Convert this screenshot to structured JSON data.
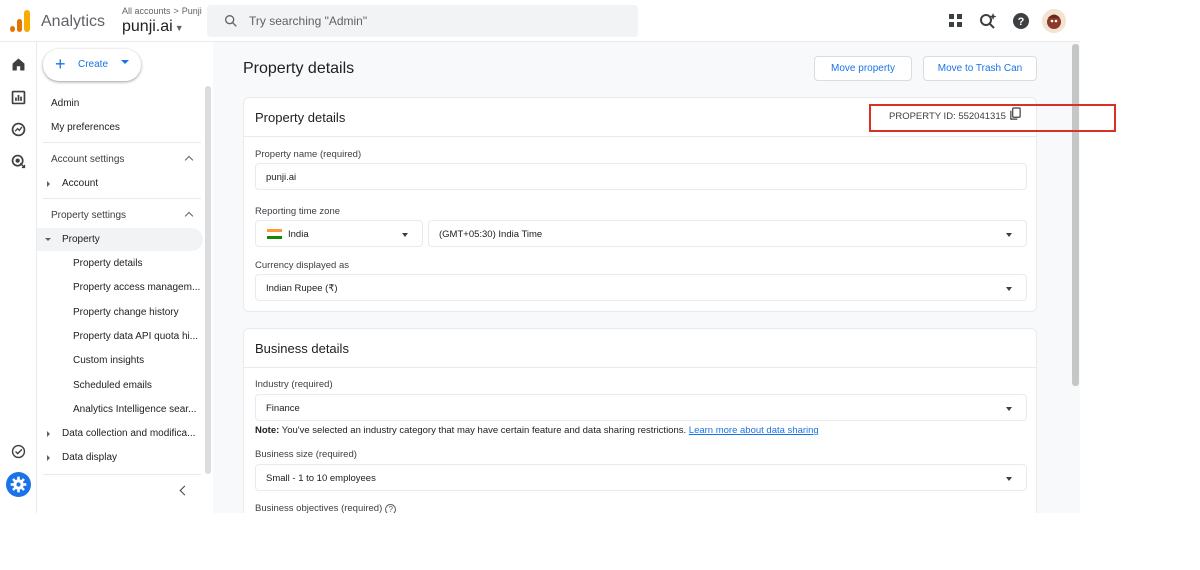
{
  "header": {
    "app_title": "Analytics",
    "breadcrumb": [
      "All accounts",
      "Punji"
    ],
    "account_name": "punji.ai",
    "search_placeholder": "Try searching \"Admin\""
  },
  "icons": {
    "top": [
      "apps-grid-icon",
      "search-insights-icon",
      "help-icon",
      "avatar"
    ],
    "rail": [
      "home-icon",
      "reports-icon",
      "explore-icon",
      "advertising-icon",
      "checklist-icon",
      "admin-gear-icon"
    ]
  },
  "nav": {
    "create_label": "Create",
    "admin": "Admin",
    "my_preferences": "My preferences",
    "account_settings": "Account settings",
    "account": "Account",
    "property_settings": "Property settings",
    "property": "Property",
    "property_items": [
      "Property details",
      "Property access managem...",
      "Property change history",
      "Property data API quota hi...",
      "Custom insights",
      "Scheduled emails",
      "Analytics Intelligence sear..."
    ],
    "data_collection": "Data collection and modifica...",
    "data_display": "Data display"
  },
  "page": {
    "title": "Property details",
    "move_property": "Move property",
    "move_to_trash": "Move to Trash Can"
  },
  "property_card": {
    "title": "Property details",
    "property_id": "PROPERTY ID: 552041315",
    "name_label": "Property name (required)",
    "name_value": "punji.ai",
    "timezone_label": "Reporting time zone",
    "country_value": "India",
    "timezone_value": "(GMT+05:30) India Time",
    "currency_label": "Currency displayed as",
    "currency_value": "Indian Rupee (₹)"
  },
  "business_card": {
    "title": "Business details",
    "industry_label": "Industry (required)",
    "industry_value": "Finance",
    "note_bold": "Note:",
    "note_text": " You've selected an industry category that may have certain feature and data sharing restrictions. ",
    "note_link": "Learn more about data sharing",
    "size_label": "Business size (required)",
    "size_value": "Small - 1 to 10 employees",
    "objectives_label": "Business objectives (required)"
  },
  "colors": {
    "accent": "#1a73e8",
    "highlight": "#d93025",
    "logo_orange": "#e37400",
    "logo_yellow": "#f9ab00"
  }
}
